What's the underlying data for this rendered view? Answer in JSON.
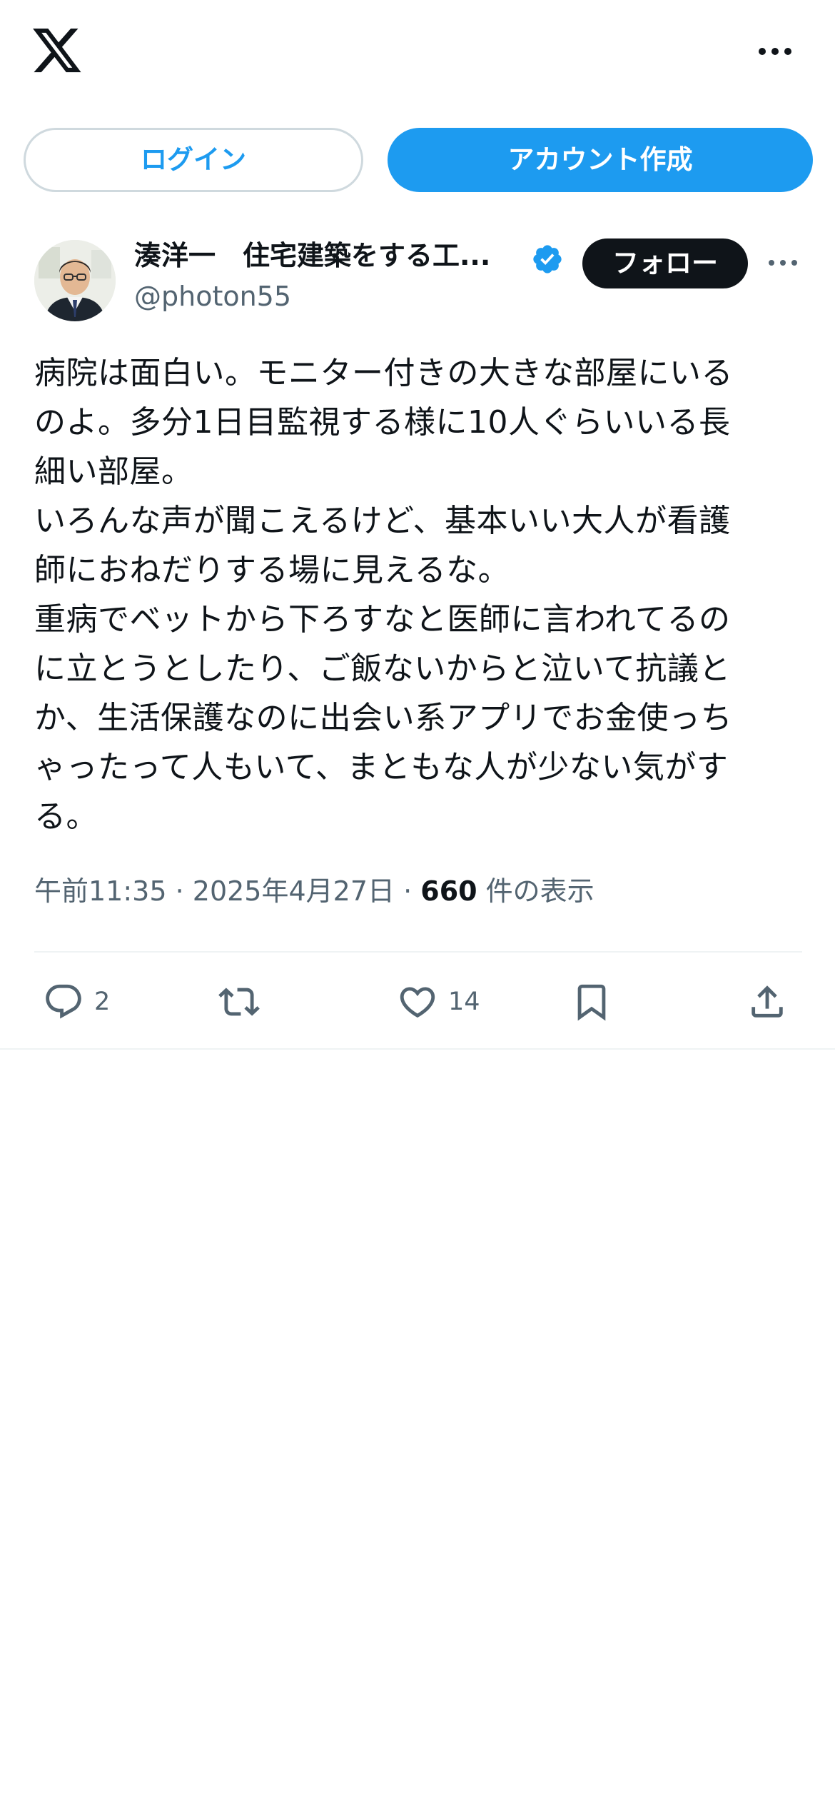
{
  "header": {
    "logo_icon": "x-logo-icon",
    "more_icon": "more-horizontal-icon"
  },
  "auth": {
    "login_label": "ログイン",
    "signup_label": "アカウント作成"
  },
  "tweet": {
    "author": {
      "display_name": "湊洋一　住宅建築をする工...",
      "handle": "@photon55",
      "verified": true,
      "verified_icon": "verified-badge-icon"
    },
    "follow_label": "フォロー",
    "text": "病院は面白い。モニター付きの大きな部屋にいる\nのよ。多分1日目監視する様に10人ぐらいいる長\n細い部屋。\nいろんな声が聞こえるけど、基本いい大人が看護\n師におねだりする場に見えるな。\n重病でベットから下ろすなと医師に言われてるの\nに立とうとしたり、ご飯ないからと泣いて抗議と\nか、生活保護なのに出会い系アプリでお金使っち\nゃったって人もいて、まともな人が少ない気がす\nる。",
    "time": "午前11:35",
    "separator": " · ",
    "date": "2025年4月27日",
    "views_count": "660",
    "views_label": " 件の表示",
    "actions": {
      "reply_count": "2",
      "like_count": "14"
    }
  },
  "colors": {
    "accent": "#1d9bf0",
    "text_primary": "#0f1419",
    "text_secondary": "#536471",
    "border": "#cfd9de"
  }
}
